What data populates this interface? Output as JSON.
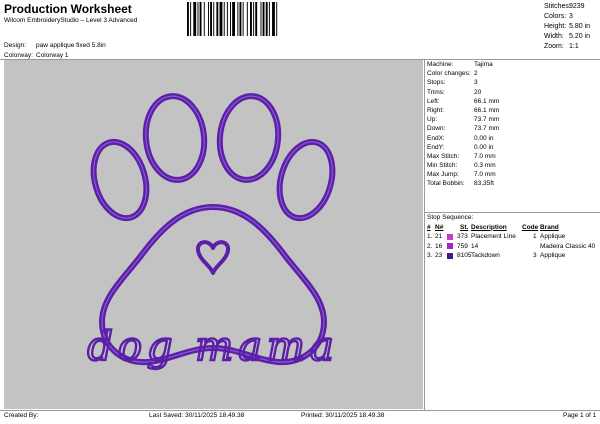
{
  "header": {
    "title": "Production Worksheet",
    "subtitle": "Wilcom EmbroideryStudio – Level 3 Advanced"
  },
  "stats": [
    {
      "label": "Stitches:",
      "value": "9239"
    },
    {
      "label": "Colors:",
      "value": "3"
    },
    {
      "label": "Height:",
      "value": "5.80 in"
    },
    {
      "label": "Width:",
      "value": "5.20 in"
    },
    {
      "label": "Zoom:",
      "value": "1:1"
    }
  ],
  "design_info": [
    {
      "label": "Design:",
      "value": "paw applique fixed 5.8in"
    },
    {
      "label": "Colorway:",
      "value": "Colorway 1"
    }
  ],
  "artwork": {
    "text": "dog mama",
    "thread_color": "#5b1fa8",
    "background": "#c3c3c3"
  },
  "properties": [
    {
      "label": "Machine:",
      "value": "Tajima"
    },
    {
      "label": "Color changes:",
      "value": "2"
    },
    {
      "label": "Stops:",
      "value": "3"
    },
    {
      "label": "Trims:",
      "value": "20"
    },
    {
      "label": "Left:",
      "value": "66.1 mm"
    },
    {
      "label": "Right:",
      "value": "66.1 mm"
    },
    {
      "label": "Up:",
      "value": "73.7 mm"
    },
    {
      "label": "Down:",
      "value": "73.7 mm"
    },
    {
      "label": "EndX:",
      "value": "0.00 in"
    },
    {
      "label": "EndY:",
      "value": "0.00 in"
    },
    {
      "label": "Max Stitch:",
      "value": "7.0 mm"
    },
    {
      "label": "Min Stitch:",
      "value": "0.3 mm"
    },
    {
      "label": "Max Jump:",
      "value": "7.0 mm"
    },
    {
      "label": "Total Bobbin:",
      "value": "83.35ft"
    }
  ],
  "stop_sequence": {
    "title": "Stop Sequence:",
    "headers": {
      "num": "#",
      "n": "N#",
      "st": "St.",
      "description": "Description",
      "code": "Code",
      "brand": "Brand"
    },
    "rows": [
      {
        "num": "1.",
        "n": "21",
        "color": "#c040c8",
        "st": "373",
        "description": "Placement Line",
        "code": "1",
        "brand": "Applique"
      },
      {
        "num": "2.",
        "n": "16",
        "color": "#a626c8",
        "st": "759",
        "description": "14",
        "code": "",
        "brand": "Madeira Classic 40"
      },
      {
        "num": "3.",
        "n": "23",
        "color": "#4a1890",
        "st": "8105",
        "description": "Tackdown",
        "code": "3",
        "brand": "Applique"
      }
    ]
  },
  "footer": {
    "created": "Created By:",
    "last_saved": "Last Saved: 30/11/2025 18.49.38",
    "printed": "Printed: 30/11/2025 18.49.38",
    "page": "Page 1 of 1"
  }
}
